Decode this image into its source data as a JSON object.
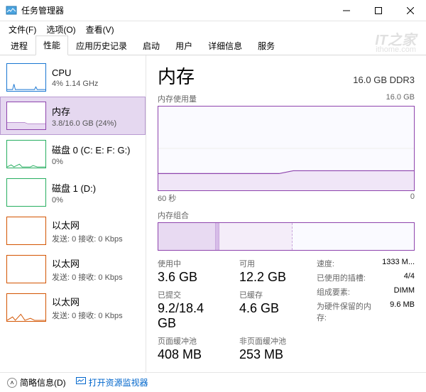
{
  "window": {
    "title": "任务管理器"
  },
  "menu": {
    "file": "文件(F)",
    "options": "选项(O)",
    "view": "查看(V)"
  },
  "tabs": [
    "进程",
    "性能",
    "应用历史记录",
    "启动",
    "用户",
    "详细信息",
    "服务"
  ],
  "active_tab": 1,
  "sidebar": {
    "items": [
      {
        "title": "CPU",
        "sub": "4% 1.14 GHz",
        "kind": "cpu"
      },
      {
        "title": "内存",
        "sub": "3.8/16.0 GB (24%)",
        "kind": "mem"
      },
      {
        "title": "磁盘 0 (C: E: F: G:)",
        "sub": "0%",
        "kind": "disk"
      },
      {
        "title": "磁盘 1 (D:)",
        "sub": "0%",
        "kind": "disk"
      },
      {
        "title": "以太网",
        "sub": "发送: 0 接收: 0 Kbps",
        "kind": "eth"
      },
      {
        "title": "以太网",
        "sub": "发送: 0 接收: 0 Kbps",
        "kind": "eth"
      },
      {
        "title": "以太网",
        "sub": "发送: 0 接收: 0 Kbps",
        "kind": "eth"
      }
    ],
    "selected": 1
  },
  "detail": {
    "title": "内存",
    "spec": "16.0 GB DDR3",
    "chart1_label": "内存使用量",
    "chart1_max": "16.0 GB",
    "axis_left": "60 秒",
    "axis_right": "0",
    "chart2_label": "内存组合",
    "stats": {
      "in_use_label": "使用中",
      "in_use": "3.6 GB",
      "avail_label": "可用",
      "avail": "12.2 GB",
      "committed_label": "已提交",
      "committed": "9.2/18.4 GB",
      "cached_label": "已缓存",
      "cached": "4.6 GB",
      "paged_label": "页面缓冲池",
      "paged": "408 MB",
      "nonpaged_label": "非页面缓冲池",
      "nonpaged": "253 MB"
    },
    "right": {
      "speed_k": "速度:",
      "speed_v": "1333 M...",
      "slots_k": "已使用的插槽:",
      "slots_v": "4/4",
      "form_k": "组成要素:",
      "form_v": "DIMM",
      "hw_k": "为硬件保留的内存:",
      "hw_v": "9.6 MB"
    }
  },
  "footer": {
    "collapse": "简略信息(D)",
    "link": "打开资源监视器"
  },
  "watermark": {
    "brand": "IT之家",
    "url": "ithome.com"
  },
  "chart_data": {
    "type": "area",
    "title": "内存使用量",
    "ylabel": "GB",
    "ylim": [
      0,
      16.0
    ],
    "xlim_seconds": [
      60,
      0
    ],
    "series": [
      {
        "name": "used_gb",
        "values": [
          3.2,
          3.2,
          3.2,
          3.2,
          3.2,
          3.2,
          3.2,
          3.2,
          3.2,
          3.2,
          3.8,
          3.8,
          3.8,
          3.8,
          3.8,
          3.8,
          3.8,
          3.8,
          3.8,
          3.8
        ]
      }
    ],
    "composition_bar": {
      "unit": "GB",
      "segments": [
        {
          "name": "in_use",
          "value": 3.6
        },
        {
          "name": "modified",
          "value": 0.2
        },
        {
          "name": "standby",
          "value": 4.6
        },
        {
          "name": "free",
          "value": 7.6
        }
      ],
      "total": 16.0
    }
  }
}
